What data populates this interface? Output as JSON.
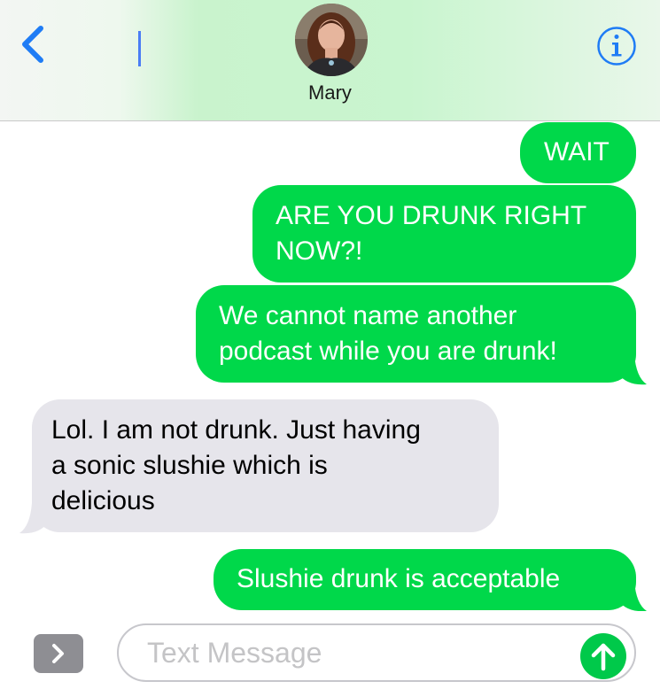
{
  "header": {
    "contact_name": "Mary",
    "back_icon": "chevron-left-icon",
    "info_icon": "info-icon"
  },
  "messages": [
    {
      "direction": "outgoing",
      "text": "WAIT"
    },
    {
      "direction": "outgoing",
      "lines": [
        "ARE YOU DRUNK RIGHT",
        "NOW?!"
      ]
    },
    {
      "direction": "outgoing",
      "lines": [
        "We cannot name another",
        "podcast while you are drunk!"
      ]
    },
    {
      "direction": "incoming",
      "lines": [
        "Lol. I am not drunk. Just having",
        "a sonic slushie which is",
        "delicious"
      ]
    },
    {
      "direction": "outgoing",
      "text": "Slushie drunk is acceptable"
    }
  ],
  "composer": {
    "placeholder": "Text Message",
    "expand_icon": "chevron-right-icon",
    "send_icon": "arrow-up-icon"
  },
  "colors": {
    "outgoing_bubble": "#00d84a",
    "incoming_bubble": "#e6e5eb",
    "accent_blue": "#1f7cf5",
    "send_button": "#00c94a"
  }
}
